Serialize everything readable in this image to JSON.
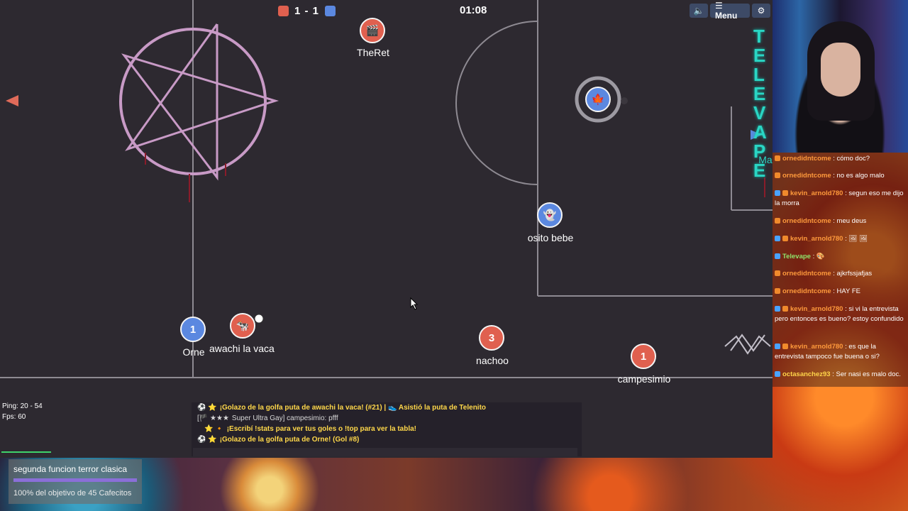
{
  "scoreboard": {
    "score": "1 - 1",
    "timer": "01:08",
    "red_color": "#e0604f",
    "blue_color": "#5b88e0"
  },
  "top_buttons": {
    "sound_icon": "speaker-icon",
    "menu_label": "☰ Menu",
    "settings_icon": "gear-icon"
  },
  "players": [
    {
      "name": "TheRet",
      "team": "red",
      "avatar": "🎬"
    },
    {
      "name": "osito bebe",
      "team": "blue",
      "avatar": "👻"
    },
    {
      "name": "",
      "team": "blue",
      "avatar": "🍁"
    },
    {
      "name": "Orne",
      "team": "blue",
      "avatar": "1"
    },
    {
      "name": "awachi la vaca",
      "team": "red",
      "avatar": "🐄"
    },
    {
      "name": "nachoo",
      "team": "red",
      "avatar": "3"
    },
    {
      "name": "campesimio",
      "team": "red",
      "avatar": "1"
    },
    {
      "name": "Ma",
      "team": "blue",
      "avatar": ""
    }
  ],
  "field_text": {
    "side_text": "TELEVAPE"
  },
  "stats": {
    "ping": "Ping: 20 - 54",
    "fps": "Fps: 60"
  },
  "game_chat": [
    {
      "icon": "⚽ ⭐",
      "text": "¡Golazo de la golfa puta de awachi la vaca! (#21) | 👟 Asistió la puta de Telenito",
      "style": "yellow"
    },
    {
      "icon": "[🏴 ★★★",
      "text": "Super Ultra Gay] campesimio: pfff",
      "style": "white"
    },
    {
      "icon": "⭐ 🔸",
      "text": "¡Escribí !stats para ver tus goles o !top para ver la tabla!",
      "style": "yellow"
    },
    {
      "icon": "⚽ ⭐",
      "text": "¡Golazo de la golfa puta de Orne! (Gol #8)",
      "style": "yellow"
    }
  ],
  "twitch_chat": [
    {
      "user": "ornedidntcome",
      "msg": "cómo doc?",
      "color": "orange"
    },
    {
      "user": "ornedidntcome",
      "msg": "no es algo malo",
      "color": "orange"
    },
    {
      "user": "kevin_arnold780",
      "msg": "segun eso me dijo la morra",
      "color": "orange"
    },
    {
      "user": "ornedidntcome",
      "msg": "meu deus",
      "color": "orange"
    },
    {
      "user": "kevin_arnold780",
      "msg": "🖼 🖼",
      "color": "orange"
    },
    {
      "user": "Televape",
      "msg": "🎨",
      "color": "green"
    },
    {
      "user": "ornedidntcome",
      "msg": "ajkrfssjafjas",
      "color": "orange"
    },
    {
      "user": "ornedidntcome",
      "msg": "HAY FE",
      "color": "orange"
    },
    {
      "user": "kevin_arnold780",
      "msg": "si vi la entrevista pero entonces es bueno? estoy confundido",
      "color": "orange"
    },
    {
      "user": "kevin_arnold780",
      "msg": "es que la entrevista tampoco fue buena o si?",
      "color": "orange"
    },
    {
      "user": "octasanchez93",
      "msg": "Ser nasi es malo doc.",
      "color": "yellow"
    }
  ],
  "goal_widget": {
    "title": "segunda funcion terror clasica",
    "subtitle": "100% del objetivo de 45 Cafecitos",
    "progress": 1.0
  }
}
